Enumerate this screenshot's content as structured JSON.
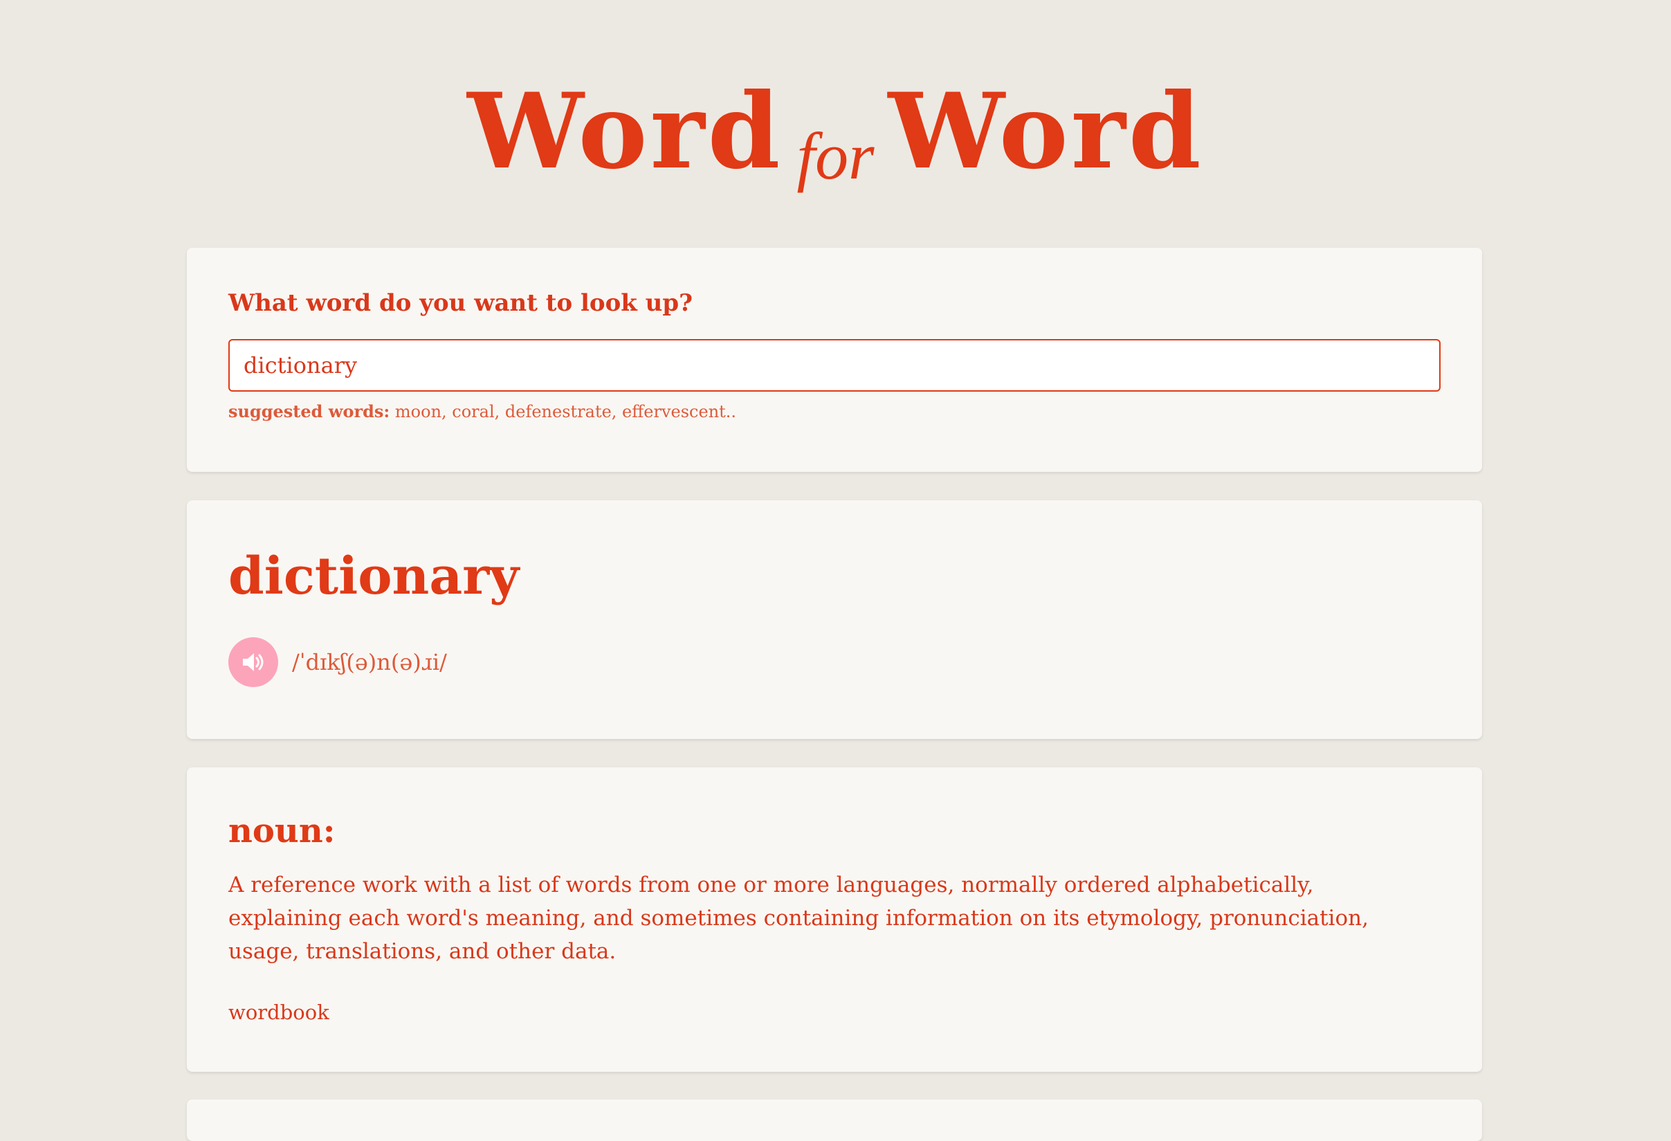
{
  "header": {
    "title_part1": "Word",
    "title_joiner": "for",
    "title_part2": "Word"
  },
  "search": {
    "label": "What word do you want to look up?",
    "value": "dictionary",
    "suggested_label": "suggested words:",
    "suggested_words": "moon, coral, defenestrate, effervescent.."
  },
  "word": {
    "headword": "dictionary",
    "phonetic": "/ˈdɪkʃ(ə)n(ə)ɹi/",
    "audio_icon": "speaker-icon"
  },
  "meanings": [
    {
      "part_of_speech": "noun:",
      "definition": "A reference work with a list of words from one or more languages, normally ordered alphabetically, explaining each word's meaning, and sometimes containing information on its etymology, pronunciation, usage, translations, and other data.",
      "synonym": "wordbook"
    }
  ],
  "colors": {
    "accent": "#E03A16",
    "background": "#ECE9E3",
    "card": "#F9F7F3",
    "audio_button": "#FCA4BA"
  }
}
